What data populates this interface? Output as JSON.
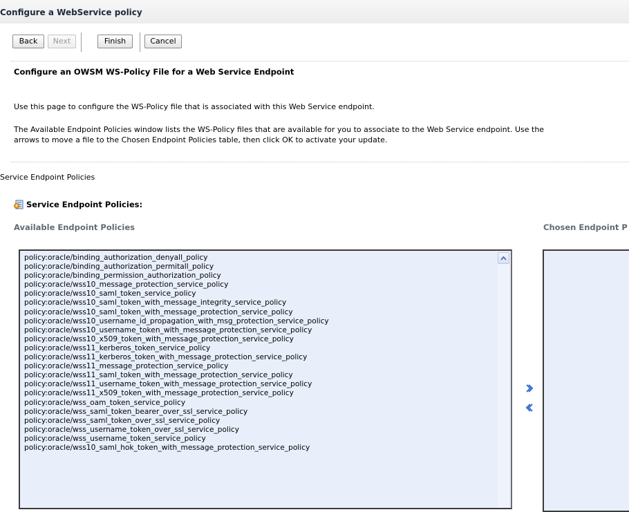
{
  "page": {
    "title": "Configure a WebService policy"
  },
  "toolbar": {
    "back_label": "Back",
    "next_label": "Next",
    "finish_label": "Finish",
    "cancel_label": "Cancel"
  },
  "content": {
    "heading": "Configure an OWSM WS-Policy File for a Web Service Endpoint",
    "intro": "Use this page to configure the WS-Policy file that is associated with this Web Service endpoint.",
    "instructions_line1": "The Available Endpoint Policies window lists the WS-Policy files that are available for you to associate to the Web Service endpoint. Use the",
    "instructions_line2": "arrows to move a file to the Chosen Endpoint Policies table, then click OK to activate your update.",
    "section_label": "Service Endpoint Policies",
    "section_title": "Service Endpoint Policies:",
    "section_icon": "policy-form-icon",
    "available_header": "Available Endpoint Policies",
    "chosen_header": "Chosen Endpoint P"
  },
  "available_policies": [
    "policy:oracle/binding_authorization_denyall_policy",
    "policy:oracle/binding_authorization_permitall_policy",
    "policy:oracle/binding_permission_authorization_policy",
    "policy:oracle/wss10_message_protection_service_policy",
    "policy:oracle/wss10_saml_token_service_policy",
    "policy:oracle/wss10_saml_token_with_message_integrity_service_policy",
    "policy:oracle/wss10_saml_token_with_message_protection_service_policy",
    "policy:oracle/wss10_username_id_propagation_with_msg_protection_service_policy",
    "policy:oracle/wss10_username_token_with_message_protection_service_policy",
    "policy:oracle/wss10_x509_token_with_message_protection_service_policy",
    "policy:oracle/wss11_kerberos_token_service_policy",
    "policy:oracle/wss11_kerberos_token_with_message_protection_service_policy",
    "policy:oracle/wss11_message_protection_service_policy",
    "policy:oracle/wss11_saml_token_with_message_protection_service_policy",
    "policy:oracle/wss11_username_token_with_message_protection_service_policy",
    "policy:oracle/wss11_x509_token_with_message_protection_service_policy",
    "policy:oracle/wss_oam_token_service_policy",
    "policy:oracle/wss_saml_token_bearer_over_ssl_service_policy",
    "policy:oracle/wss_saml_token_over_ssl_service_policy",
    "policy:oracle/wss_username_token_over_ssl_service_policy",
    "policy:oracle/wss_username_token_service_policy",
    "policy:oracle/wss10_saml_hok_token_with_message_protection_service_policy"
  ],
  "icons": {
    "move_right": "double-chevron-right-icon",
    "move_left": "double-chevron-left-icon",
    "scroll_up": "scroll-up-arrow-icon"
  },
  "colors": {
    "list_background": "#e8effb",
    "arrow_blue": "#3a6fd0",
    "column_header": "#616b75"
  }
}
